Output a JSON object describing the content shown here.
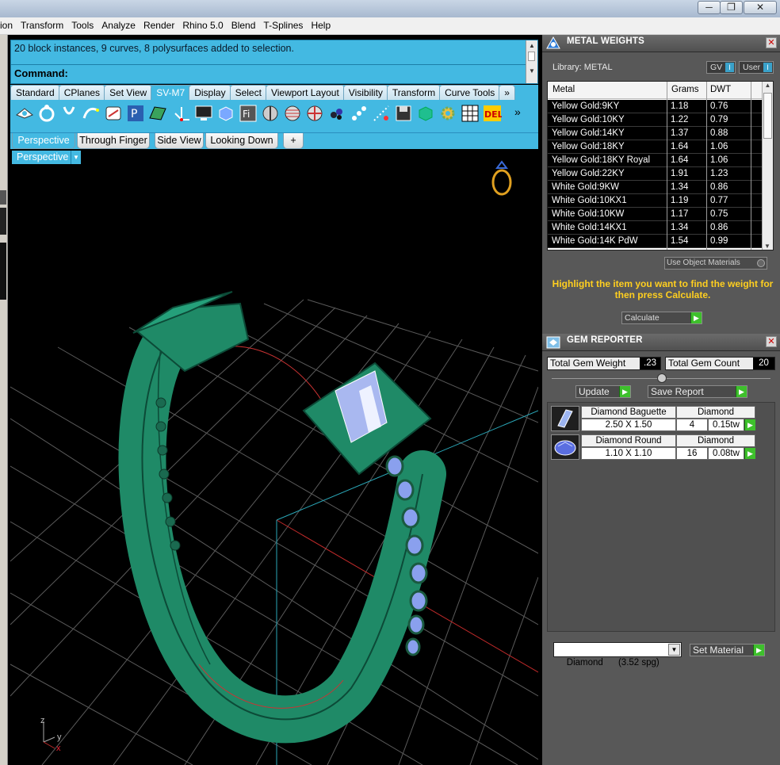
{
  "menu": [
    "ion",
    "Transform",
    "Tools",
    "Analyze",
    "Render",
    "Rhino 5.0",
    "Blend",
    "T-Splines",
    "Help"
  ],
  "window_controls": {
    "minimize": "─",
    "restore": "❐",
    "close": "✕"
  },
  "command": {
    "history": "20 block instances, 9 curves, 8 polysurfaces added to selection.",
    "prompt": "Command:"
  },
  "toolbar_tabs": [
    "Standard",
    "CPlanes",
    "Set View",
    "SV-M7",
    "Display",
    "Select",
    "Viewport Layout",
    "Visibility",
    "Transform",
    "Curve Tools",
    "»"
  ],
  "toolbar_active": "SV-M7",
  "icon_more": "»",
  "view_tabs": [
    "Perspective",
    "Through Finger",
    "Side View",
    "Looking Down",
    "+"
  ],
  "viewport": {
    "label": "Perspective",
    "dropdown_arrow": "▼",
    "axis": {
      "z": "z",
      "y": "y",
      "x": "x"
    }
  },
  "metal_weights": {
    "title": "METAL WEIGHTS",
    "close": "✕",
    "library": "Library: METAL",
    "gv_label": "GV",
    "user_label": "User",
    "toggle": "I",
    "columns": [
      "Metal",
      "Grams",
      "DWT"
    ],
    "rows": [
      [
        "Yellow Gold:9KY",
        "1.18",
        "0.76"
      ],
      [
        "Yellow Gold:10KY",
        "1.22",
        "0.79"
      ],
      [
        "Yellow Gold:14KY",
        "1.37",
        "0.88"
      ],
      [
        "Yellow Gold:18KY",
        "1.64",
        "1.06"
      ],
      [
        "Yellow Gold:18KY Royal",
        "1.64",
        "1.06"
      ],
      [
        "Yellow Gold:22KY",
        "1.91",
        "1.23"
      ],
      [
        "White Gold:9KW",
        "1.34",
        "0.86"
      ],
      [
        "White Gold:10KX1",
        "1.19",
        "0.77"
      ],
      [
        "White Gold:10KW",
        "1.17",
        "0.75"
      ],
      [
        "White Gold:14KX1",
        "1.34",
        "0.86"
      ],
      [
        "White Gold:14K PdW",
        "1.54",
        "0.99"
      ]
    ],
    "use_object_materials": "Use Object Materials",
    "hint": "Highlight the item you want to find the weight for then press Calculate.",
    "calculate": "Calculate"
  },
  "gem_reporter": {
    "title": "GEM REPORTER",
    "close": "✕",
    "total_weight_label": "Total Gem Weight",
    "total_weight": ".23",
    "total_count_label": "Total Gem Count",
    "total_count": "20",
    "update": "Update",
    "save_report": "Save Report",
    "gems": [
      {
        "name": "Diamond Baguette",
        "material": "Diamond",
        "size": "2.50 X 1.50",
        "count": "4",
        "weight": "0.15tw"
      },
      {
        "name": "Diamond Round",
        "material": "Diamond",
        "size": "1.10 X 1.10",
        "count": "16",
        "weight": "0.08tw"
      }
    ],
    "material_select": "Diamond      (3.52 spg)",
    "set_material": "Set Material"
  },
  "arrow_glyph": "▶",
  "colors": {
    "rhino_blue": "#43b9e2",
    "ring_green": "#1f8a67",
    "gem_blue": "#6b86e8",
    "panel_gray": "#585858",
    "hint_yellow": "#ffcf1f",
    "accent_green": "#3ec02c"
  }
}
